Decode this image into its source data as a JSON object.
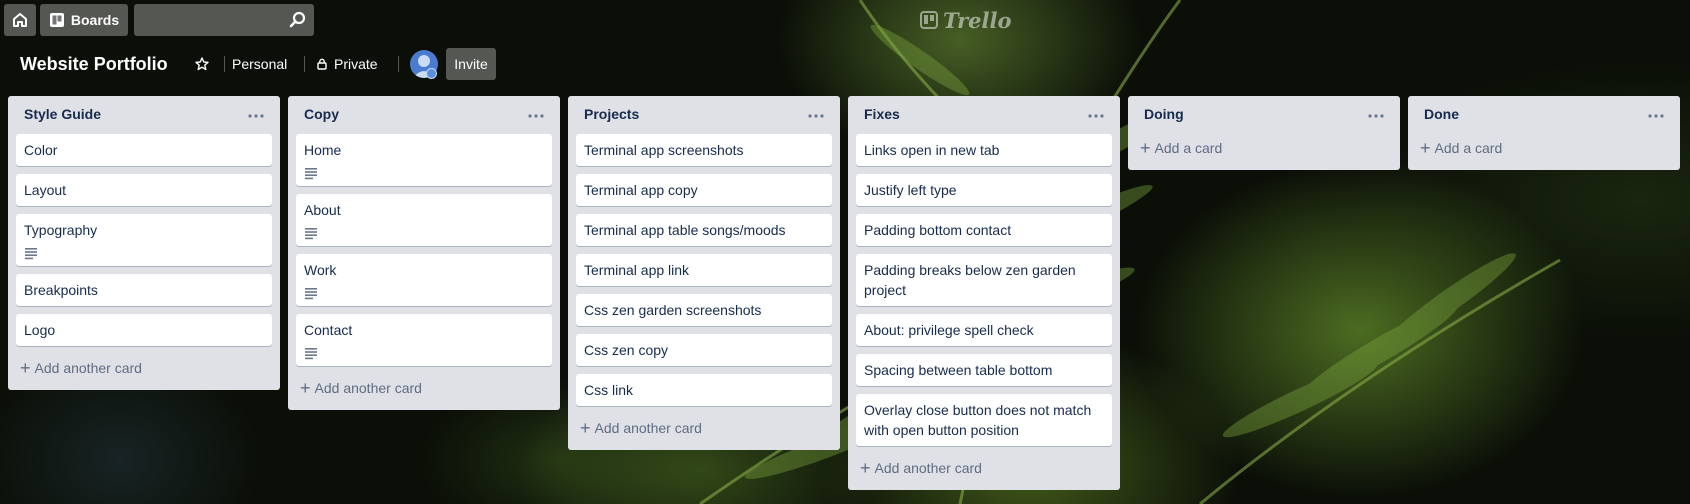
{
  "header": {
    "boards_label": "Boards",
    "search_placeholder": "",
    "logo_text": "Trello"
  },
  "board": {
    "title": "Website Portfolio",
    "team_label": "Personal",
    "visibility_label": "Private",
    "invite_label": "Invite"
  },
  "lists": [
    {
      "title": "Style Guide",
      "cards": [
        {
          "title": "Color",
          "has_description": false
        },
        {
          "title": "Layout",
          "has_description": false
        },
        {
          "title": "Typography",
          "has_description": true
        },
        {
          "title": "Breakpoints",
          "has_description": false
        },
        {
          "title": "Logo",
          "has_description": false
        }
      ],
      "add_label": "Add another card"
    },
    {
      "title": "Copy",
      "cards": [
        {
          "title": "Home",
          "has_description": true
        },
        {
          "title": "About",
          "has_description": true
        },
        {
          "title": "Work",
          "has_description": true
        },
        {
          "title": "Contact",
          "has_description": true
        }
      ],
      "add_label": "Add another card"
    },
    {
      "title": "Projects",
      "cards": [
        {
          "title": "Terminal app screenshots",
          "has_description": false
        },
        {
          "title": "Terminal app copy",
          "has_description": false
        },
        {
          "title": "Terminal app table songs/moods",
          "has_description": false
        },
        {
          "title": "Terminal app link",
          "has_description": false
        },
        {
          "title": "Css zen garden screenshots",
          "has_description": false
        },
        {
          "title": "Css zen copy",
          "has_description": false
        },
        {
          "title": "Css link",
          "has_description": false
        }
      ],
      "add_label": "Add another card"
    },
    {
      "title": "Fixes",
      "cards": [
        {
          "title": "Links open in new tab",
          "has_description": false
        },
        {
          "title": "Justify left type",
          "has_description": false
        },
        {
          "title": "Padding bottom contact",
          "has_description": false
        },
        {
          "title": "Padding breaks below zen garden project",
          "has_description": false
        },
        {
          "title": "About: privilege spell check",
          "has_description": false
        },
        {
          "title": "Spacing between table bottom",
          "has_description": false
        },
        {
          "title": "Overlay close button does not match with open button position",
          "has_description": false
        }
      ],
      "add_label": "Add another card"
    },
    {
      "title": "Doing",
      "cards": [],
      "add_label": "Add a card"
    },
    {
      "title": "Done",
      "cards": [],
      "add_label": "Add a card"
    }
  ],
  "colors": {
    "list_bg": "#dfe1e6",
    "card_text": "#172b4d",
    "muted_text": "#5e6c84"
  }
}
